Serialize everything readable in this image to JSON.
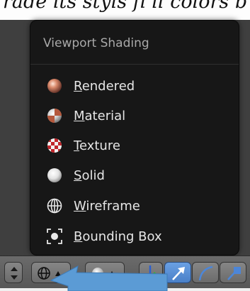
{
  "document": {
    "top_text": "rade its styls fi ll colors b"
  },
  "menu": {
    "title": "Viewport Shading",
    "items": [
      {
        "label": "Rendered",
        "icon": "rendered-sphere-icon"
      },
      {
        "label": "Material",
        "icon": "material-sphere-icon"
      },
      {
        "label": "Texture",
        "icon": "texture-checker-sphere-icon"
      },
      {
        "label": "Solid",
        "icon": "solid-sphere-icon"
      },
      {
        "label": "Wireframe",
        "icon": "wireframe-sphere-icon"
      },
      {
        "label": "Bounding Box",
        "icon": "bounding-box-icon"
      }
    ]
  },
  "header": {
    "buttons": [
      {
        "name": "editor-type-updown-button",
        "icon": "up-down-arrows-icon"
      },
      {
        "name": "viewport-shading-dropdown",
        "icon": "wireframe-sphere-icon"
      },
      {
        "name": "pivot-point-dropdown",
        "icon": "solid-sphere-icon"
      },
      {
        "name": "manipulator-toggle",
        "icon": "axis-gizmo-icon"
      },
      {
        "name": "translate-manipulator-button",
        "icon": "arrow-icon",
        "active": true
      },
      {
        "name": "rotate-manipulator-button",
        "icon": "arc-icon"
      },
      {
        "name": "scale-manipulator-button",
        "icon": "scale-arrow-icon"
      }
    ]
  },
  "colors": {
    "menu_bg": "#171717",
    "menu_text": "#e6e6e6",
    "menu_title": "#a9a9a9",
    "active_button": "#5a90d8",
    "pointer_arrow": "#5b9bd5"
  }
}
